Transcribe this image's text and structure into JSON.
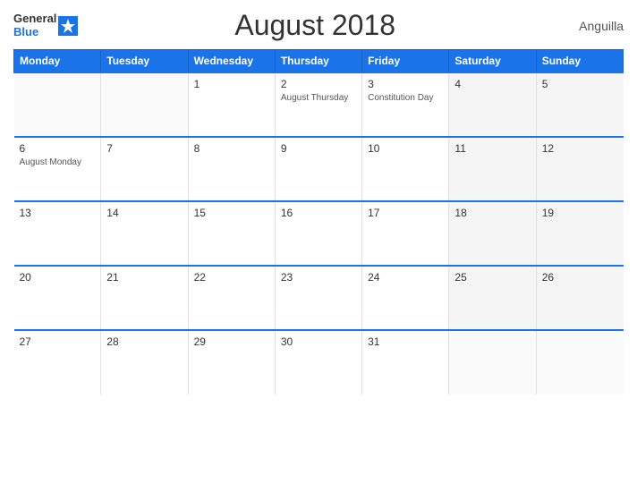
{
  "header": {
    "logo_line1": "General",
    "logo_line2": "Blue",
    "title": "August 2018",
    "country": "Anguilla"
  },
  "days_of_week": [
    "Monday",
    "Tuesday",
    "Wednesday",
    "Thursday",
    "Friday",
    "Saturday",
    "Sunday"
  ],
  "weeks": [
    [
      {
        "day": "",
        "event": "",
        "empty": true
      },
      {
        "day": "",
        "event": "",
        "empty": true
      },
      {
        "day": "1",
        "event": ""
      },
      {
        "day": "2",
        "event": "August Thursday"
      },
      {
        "day": "3",
        "event": "Constitution Day"
      },
      {
        "day": "4",
        "event": ""
      },
      {
        "day": "5",
        "event": ""
      }
    ],
    [
      {
        "day": "6",
        "event": "August Monday"
      },
      {
        "day": "7",
        "event": ""
      },
      {
        "day": "8",
        "event": ""
      },
      {
        "day": "9",
        "event": ""
      },
      {
        "day": "10",
        "event": ""
      },
      {
        "day": "11",
        "event": ""
      },
      {
        "day": "12",
        "event": ""
      }
    ],
    [
      {
        "day": "13",
        "event": ""
      },
      {
        "day": "14",
        "event": ""
      },
      {
        "day": "15",
        "event": ""
      },
      {
        "day": "16",
        "event": ""
      },
      {
        "day": "17",
        "event": ""
      },
      {
        "day": "18",
        "event": ""
      },
      {
        "day": "19",
        "event": ""
      }
    ],
    [
      {
        "day": "20",
        "event": ""
      },
      {
        "day": "21",
        "event": ""
      },
      {
        "day": "22",
        "event": ""
      },
      {
        "day": "23",
        "event": ""
      },
      {
        "day": "24",
        "event": ""
      },
      {
        "day": "25",
        "event": ""
      },
      {
        "day": "26",
        "event": ""
      }
    ],
    [
      {
        "day": "27",
        "event": ""
      },
      {
        "day": "28",
        "event": ""
      },
      {
        "day": "29",
        "event": ""
      },
      {
        "day": "30",
        "event": ""
      },
      {
        "day": "31",
        "event": ""
      },
      {
        "day": "",
        "event": "",
        "empty": true
      },
      {
        "day": "",
        "event": "",
        "empty": true
      }
    ]
  ]
}
